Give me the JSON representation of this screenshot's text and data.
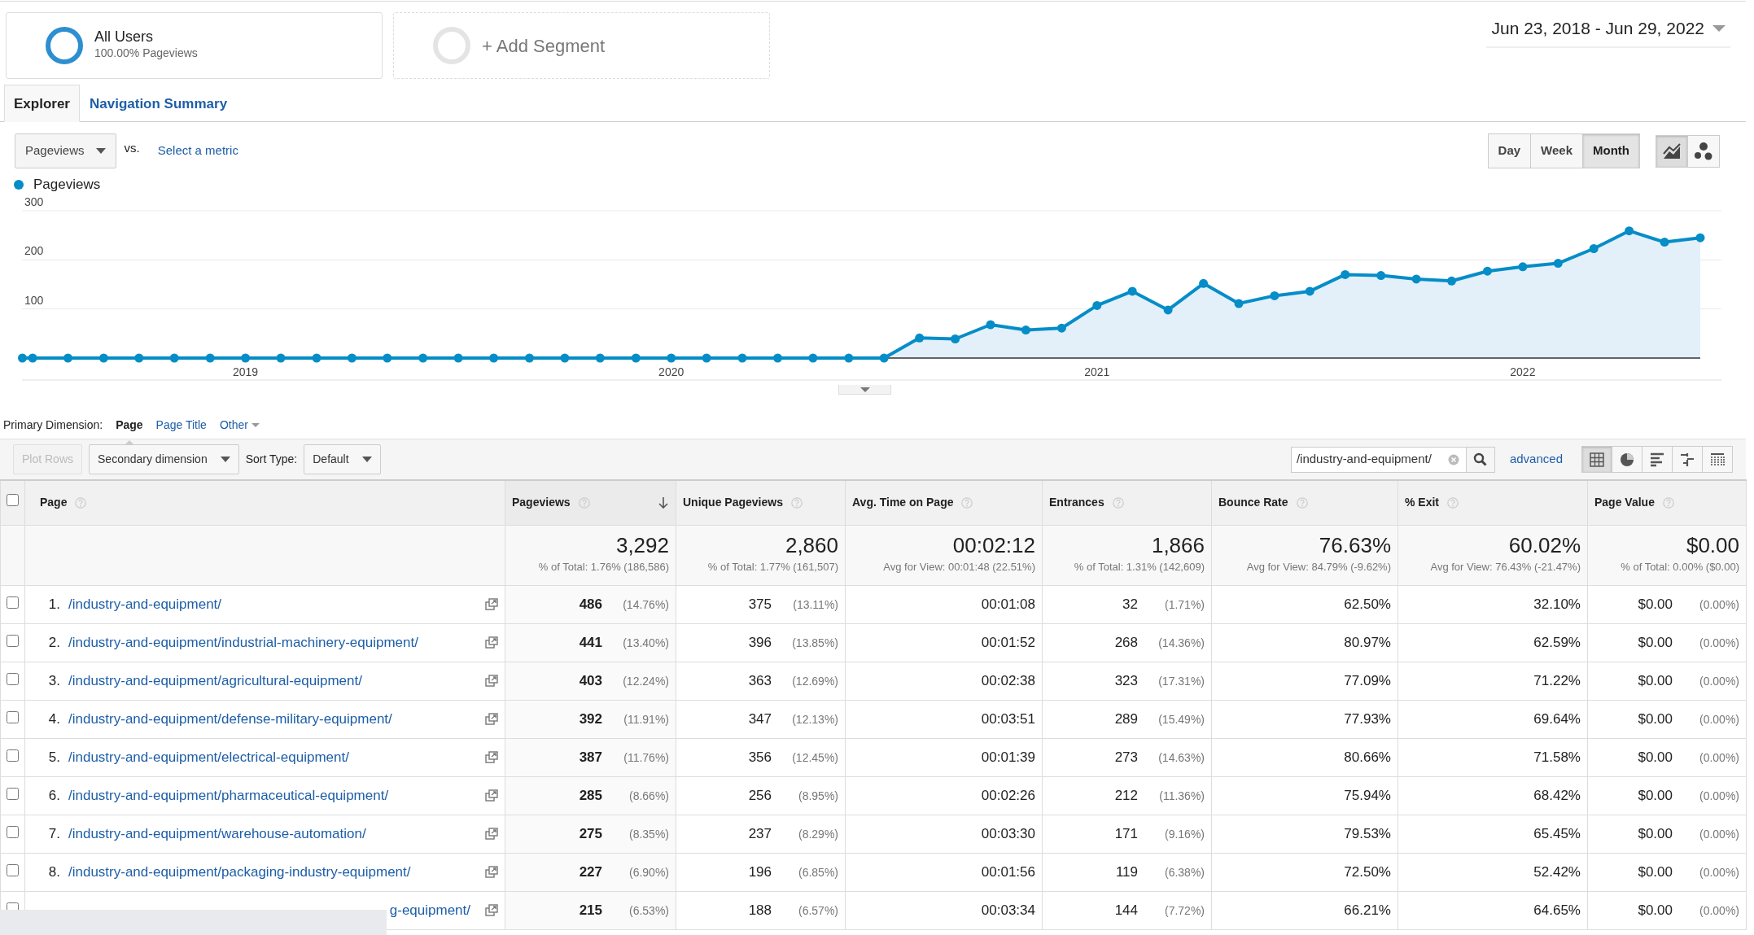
{
  "segments": [
    {
      "kind": "active",
      "name": "All Users",
      "detail": "100.00% Pageviews"
    },
    {
      "kind": "add",
      "name": "+ Add Segment"
    }
  ],
  "date_range": "Jun 23, 2018 - Jun 29, 2022",
  "tabs": [
    {
      "label": "Explorer",
      "selected": true
    },
    {
      "label": "Navigation Summary",
      "selected": false
    }
  ],
  "metric": {
    "selected": "Pageviews",
    "vs": "vs.",
    "compare_link": "Select a metric"
  },
  "granularity": [
    {
      "label": "Day",
      "selected": false
    },
    {
      "label": "Week",
      "selected": false
    },
    {
      "label": "Month",
      "selected": true
    }
  ],
  "chart_types": [
    {
      "kind": "line",
      "selected": true
    },
    {
      "kind": "motion",
      "selected": false
    }
  ],
  "chart": {
    "chart_data": {
      "type": "area",
      "x": [
        2018.476,
        2018.5,
        2018.583,
        2018.667,
        2018.75,
        2018.833,
        2018.917,
        2019,
        2019.083,
        2019.167,
        2019.25,
        2019.333,
        2019.417,
        2019.5,
        2019.583,
        2019.667,
        2019.75,
        2019.833,
        2019.917,
        2020,
        2020.083,
        2020.167,
        2020.25,
        2020.333,
        2020.417,
        2020.5,
        2020.583,
        2020.667,
        2020.75,
        2020.833,
        2020.917,
        2021,
        2021.083,
        2021.167,
        2021.25,
        2021.333,
        2021.417,
        2021.5,
        2021.583,
        2021.667,
        2021.75,
        2021.833,
        2021.917,
        2022,
        2022.083,
        2022.167,
        2022.25,
        2022.333,
        2022.417
      ],
      "series": [
        {
          "name": "Pageviews",
          "color": "#058dc7",
          "values": [
            0,
            0,
            0,
            0,
            0,
            0,
            0,
            0,
            0,
            0,
            0,
            0,
            0,
            0,
            0,
            0,
            0,
            0,
            0,
            0,
            0,
            0,
            0,
            0,
            0,
            0,
            41,
            39,
            68,
            57,
            61,
            107,
            136,
            98,
            152,
            111,
            127,
            136,
            170,
            168,
            161,
            157,
            177,
            186,
            193,
            223,
            259,
            236,
            245
          ]
        }
      ],
      "xlim": [
        2018.476,
        2022.417
      ],
      "ylim": [
        0,
        300
      ],
      "xticks": [
        2019,
        2020,
        2021,
        2022
      ],
      "yticks": [
        100,
        200,
        300
      ]
    }
  },
  "primary_dimension": {
    "label": "Primary Dimension:",
    "options": [
      {
        "kind": "option",
        "label": "Page",
        "selected": true
      },
      {
        "kind": "option",
        "label": "Page Title",
        "selected": false
      },
      {
        "kind": "menu",
        "label": "Other",
        "selected": false
      }
    ]
  },
  "toolbar": {
    "plot_rows": {
      "label": "Plot Rows",
      "disabled": true
    },
    "secondary_dimension": "Secondary dimension",
    "sort_label": "Sort Type:",
    "sort_value": "Default",
    "filter_value": "/industry-and-equipment/",
    "advanced": "advanced",
    "views": [
      {
        "kind": "table",
        "selected": true
      },
      {
        "kind": "pie",
        "selected": false
      },
      {
        "kind": "bar",
        "selected": false
      },
      {
        "kind": "comparison",
        "selected": false
      },
      {
        "kind": "pivot",
        "selected": false
      }
    ]
  },
  "table": {
    "all_checked": false,
    "columns": [
      {
        "label": "Page",
        "sorted": false
      },
      {
        "label": "Pageviews",
        "sorted": true
      },
      {
        "label": "Unique Pageviews",
        "sorted": false
      },
      {
        "label": "Avg. Time on Page",
        "sorted": false
      },
      {
        "label": "Entrances",
        "sorted": false
      },
      {
        "label": "Bounce Rate",
        "sorted": false
      },
      {
        "label": "% Exit",
        "sorted": false
      },
      {
        "label": "Page Value",
        "sorted": false
      }
    ],
    "totals": [
      {
        "value": "3,292",
        "detail": "% of Total: 1.76% (186,586)"
      },
      {
        "value": "2,860",
        "detail": "% of Total: 1.77% (161,507)"
      },
      {
        "value": "00:02:12",
        "detail": "Avg for View: 00:01:48 (22.51%)"
      },
      {
        "value": "1,866",
        "detail": "% of Total: 1.31% (142,609)"
      },
      {
        "value": "76.63%",
        "detail": "Avg for View: 84.79% (-9.62%)"
      },
      {
        "value": "60.02%",
        "detail": "Avg for View: 76.43% (-21.47%)"
      },
      {
        "value": "$0.00",
        "detail": "% of Total: 0.00% ($0.00)"
      }
    ],
    "rows": [
      {
        "checked": false,
        "covered": false,
        "number": "1.",
        "cells": [
          {
            "value": "/industry-and-equipment/"
          },
          {
            "value": "486",
            "share": "(14.76%)"
          },
          {
            "value": "375",
            "share": "(13.11%)"
          },
          {
            "value": "00:01:08"
          },
          {
            "value": "32",
            "share": "(1.71%)"
          },
          {
            "value": "62.50%"
          },
          {
            "value": "32.10%"
          },
          {
            "value": "$0.00",
            "share": "(0.00%)"
          }
        ]
      },
      {
        "checked": false,
        "covered": false,
        "number": "2.",
        "cells": [
          {
            "value": "/industry-and-equipment/industrial-machinery-equipment/"
          },
          {
            "value": "441",
            "share": "(13.40%)"
          },
          {
            "value": "396",
            "share": "(13.85%)"
          },
          {
            "value": "00:01:52"
          },
          {
            "value": "268",
            "share": "(14.36%)"
          },
          {
            "value": "80.97%"
          },
          {
            "value": "62.59%"
          },
          {
            "value": "$0.00",
            "share": "(0.00%)"
          }
        ]
      },
      {
        "checked": false,
        "covered": false,
        "number": "3.",
        "cells": [
          {
            "value": "/industry-and-equipment/agricultural-equipment/"
          },
          {
            "value": "403",
            "share": "(12.24%)"
          },
          {
            "value": "363",
            "share": "(12.69%)"
          },
          {
            "value": "00:02:38"
          },
          {
            "value": "323",
            "share": "(17.31%)"
          },
          {
            "value": "77.09%"
          },
          {
            "value": "71.22%"
          },
          {
            "value": "$0.00",
            "share": "(0.00%)"
          }
        ]
      },
      {
        "checked": false,
        "covered": false,
        "number": "4.",
        "cells": [
          {
            "value": "/industry-and-equipment/defense-military-equipment/"
          },
          {
            "value": "392",
            "share": "(11.91%)"
          },
          {
            "value": "347",
            "share": "(12.13%)"
          },
          {
            "value": "00:03:51"
          },
          {
            "value": "289",
            "share": "(15.49%)"
          },
          {
            "value": "77.93%"
          },
          {
            "value": "69.64%"
          },
          {
            "value": "$0.00",
            "share": "(0.00%)"
          }
        ]
      },
      {
        "checked": false,
        "covered": false,
        "number": "5.",
        "cells": [
          {
            "value": "/industry-and-equipment/electrical-equipment/"
          },
          {
            "value": "387",
            "share": "(11.76%)"
          },
          {
            "value": "356",
            "share": "(12.45%)"
          },
          {
            "value": "00:01:39"
          },
          {
            "value": "273",
            "share": "(14.63%)"
          },
          {
            "value": "80.66%"
          },
          {
            "value": "71.58%"
          },
          {
            "value": "$0.00",
            "share": "(0.00%)"
          }
        ]
      },
      {
        "checked": false,
        "covered": false,
        "number": "6.",
        "cells": [
          {
            "value": "/industry-and-equipment/pharmaceutical-equipment/"
          },
          {
            "value": "285",
            "share": "(8.66%)"
          },
          {
            "value": "256",
            "share": "(8.95%)"
          },
          {
            "value": "00:02:26"
          },
          {
            "value": "212",
            "share": "(11.36%)"
          },
          {
            "value": "75.94%"
          },
          {
            "value": "68.42%"
          },
          {
            "value": "$0.00",
            "share": "(0.00%)"
          }
        ]
      },
      {
        "checked": false,
        "covered": false,
        "number": "7.",
        "cells": [
          {
            "value": "/industry-and-equipment/warehouse-automation/"
          },
          {
            "value": "275",
            "share": "(8.35%)"
          },
          {
            "value": "237",
            "share": "(8.29%)"
          },
          {
            "value": "00:03:30"
          },
          {
            "value": "171",
            "share": "(9.16%)"
          },
          {
            "value": "79.53%"
          },
          {
            "value": "65.45%"
          },
          {
            "value": "$0.00",
            "share": "(0.00%)"
          }
        ]
      },
      {
        "checked": false,
        "covered": false,
        "number": "8.",
        "cells": [
          {
            "value": "/industry-and-equipment/packaging-industry-equipment/"
          },
          {
            "value": "227",
            "share": "(6.90%)"
          },
          {
            "value": "196",
            "share": "(6.85%)"
          },
          {
            "value": "00:01:56"
          },
          {
            "value": "119",
            "share": "(6.38%)"
          },
          {
            "value": "72.50%"
          },
          {
            "value": "52.42%"
          },
          {
            "value": "$0.00",
            "share": "(0.00%)"
          }
        ]
      },
      {
        "checked": false,
        "covered": true,
        "cells": [
          {
            "value": "g-equipment/"
          },
          {
            "value": "215",
            "share": "(6.53%)"
          },
          {
            "value": "188",
            "share": "(6.57%)"
          },
          {
            "value": "00:03:34"
          },
          {
            "value": "144",
            "share": "(7.72%)"
          },
          {
            "value": "66.21%"
          },
          {
            "value": "64.65%"
          },
          {
            "value": "$0.00",
            "share": "(0.00%)"
          }
        ]
      }
    ]
  }
}
